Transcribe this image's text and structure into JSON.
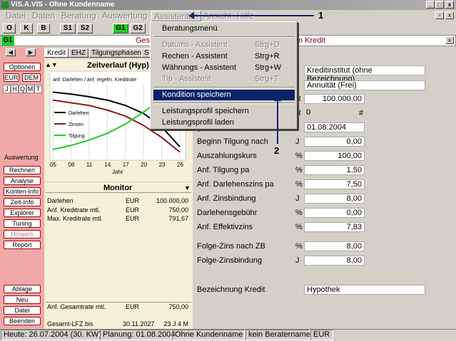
{
  "window": {
    "title": "VIS.A.VIS - Ohne Kundenname",
    "min": "_",
    "max": "□",
    "close": "x"
  },
  "menu": [
    "Datei",
    "Daten",
    "Beratung",
    "Auswertung",
    "Assistenten",
    "Ansicht",
    "Hilfe"
  ],
  "toolbar": [
    "O",
    "K",
    "B",
    "S1",
    "S2",
    "G1",
    "G2"
  ],
  "field_bar": {
    "tag": "G1",
    "text_left": "Ges",
    "text_right": "n Kredit"
  },
  "dropdown": {
    "items": [
      {
        "label": "Beratungsmenü",
        "shortcut": "",
        "state": "normal"
      },
      {
        "label": "Datums - Assistent",
        "shortcut": "Strg+D",
        "state": "disabled"
      },
      {
        "label": "Rechen - Assistent",
        "shortcut": "Strg+R",
        "state": "normal"
      },
      {
        "label": "Währungs - Assistent",
        "shortcut": "Strg+W",
        "state": "normal"
      },
      {
        "label": "Tip - Assistent",
        "shortcut": "Strg+T",
        "state": "disabled"
      },
      {
        "label": "Kondition speichern",
        "shortcut": "",
        "state": "selected"
      },
      {
        "label": "Leistungsprofil speichern",
        "shortcut": "",
        "state": "normal"
      },
      {
        "label": "Leistungsprofil laden",
        "shortcut": "",
        "state": "normal"
      }
    ]
  },
  "annotations": {
    "one": "1",
    "two": "2"
  },
  "left": {
    "options": "Optionen",
    "eur": "EUR",
    "dem": "DEM",
    "periods": [
      "J",
      "H",
      "Q",
      "M",
      "T"
    ],
    "auswertung": "Auswertung",
    "buttons": [
      "Rechnen",
      "Analyse",
      "Konten-Info",
      "Zeit-Info",
      "Explorer",
      "Tuning",
      "Hinweis",
      "Report"
    ],
    "bottom": [
      "Ablage",
      "Neu",
      "Datei",
      "Beenden"
    ]
  },
  "tabs": [
    "Kredit",
    "EHZ",
    "Tilgungsphasen",
    "S"
  ],
  "chart": {
    "title": "Zeitverlauf (Hyp)",
    "subtitle": "anf. Darlehen / anf. regelm. Kreditrate",
    "legend": [
      "Darlehen",
      "Zinsen",
      "Tilgung"
    ],
    "colors": [
      "#000000",
      "#8b1a1a",
      "#22cc22"
    ],
    "xlabel": "Jahr",
    "xticks": [
      "05",
      "08",
      "11",
      "14",
      "17",
      "20",
      "23",
      "26"
    ]
  },
  "chart_data": {
    "type": "line",
    "title": "Zeitverlauf (Hyp)",
    "xlabel": "Jahr",
    "categories": [
      "05",
      "08",
      "11",
      "14",
      "17",
      "20",
      "23",
      "26"
    ],
    "series": [
      {
        "name": "Darlehen",
        "values": [
          1.0,
          0.97,
          0.93,
          0.88,
          0.8,
          0.68,
          0.48,
          0.18
        ]
      },
      {
        "name": "Zinsen",
        "values": [
          0.88,
          0.84,
          0.8,
          0.73,
          0.64,
          0.5,
          0.32,
          0.1
        ]
      },
      {
        "name": "Tilgung",
        "values": [
          0.14,
          0.2,
          0.28,
          0.38,
          0.52,
          0.7,
          0.9,
          1.0
        ]
      }
    ],
    "ylim": [
      0,
      1.1
    ]
  },
  "monitor": {
    "title": "Monitor",
    "rows": [
      {
        "label": "Darlehen",
        "unit": "EUR",
        "value": "100.000,00"
      },
      {
        "label": "Anf. Kreditrate mtl.",
        "unit": "EUR",
        "value": "750,00"
      },
      {
        "label": "Max. Kreditrate mtl.",
        "unit": "EUR",
        "value": "791,67"
      }
    ],
    "gesamt": {
      "label": "Anf. Gesamtrate mtl.",
      "unit": "EUR",
      "value": "750,00"
    },
    "lfz": {
      "label": "Gesamt-LFZ bis",
      "date": "30.11.2027",
      "value": "23 J 4 M"
    }
  },
  "form": {
    "rows": [
      {
        "label": "",
        "unit": "",
        "value": "Kreditinstitut (ohne Bezeichnung)",
        "align": "left"
      },
      {
        "label": "",
        "unit": "",
        "value": "Annuität  (Frei)",
        "align": "left"
      },
      {
        "label": "",
        "unit": "R",
        "value": "100.000,00",
        "align": "right"
      },
      {
        "label": "",
        "unit": "R",
        "value": "0",
        "align": "left",
        "extra": "#"
      },
      {
        "label": "g",
        "unit": "",
        "value": "01.08.2004",
        "align": "left"
      },
      {
        "label": "Beginn Tilgung nach",
        "unit": "J",
        "value": "0,00",
        "align": "right"
      },
      {
        "label": "Auszahlungskurs",
        "unit": "%",
        "value": "100,00",
        "align": "right"
      },
      {
        "label": "Anf. Tilgung pa",
        "unit": "%",
        "value": "1,50",
        "align": "right"
      },
      {
        "label": "Anf. Darlehenszins pa",
        "unit": "%",
        "value": "7,50",
        "align": "right"
      },
      {
        "label": "Anf. Zinsbindung",
        "unit": "J",
        "value": "8,00",
        "align": "right"
      },
      {
        "label": "Darlehensgebühr",
        "unit": "%",
        "value": "0,00",
        "align": "right"
      },
      {
        "label": "Anf. Effektivzins",
        "unit": "%",
        "value": "7,83",
        "align": "right"
      },
      {
        "label": "Folge-Zins nach ZB",
        "unit": "%",
        "value": "8,00",
        "align": "right"
      },
      {
        "label": "Folge-Zinsbindung",
        "unit": "J",
        "value": "8,00",
        "align": "right"
      },
      {
        "label": "Bezeichnung Kredit",
        "unit": "",
        "value": "Hypothek",
        "align": "left"
      }
    ]
  },
  "status": [
    "Heute: 26.07.2004 (30. KW)",
    "Planung: 01.08.2004",
    "Ohne Kundenname",
    "kein Beratername",
    "EUR"
  ]
}
